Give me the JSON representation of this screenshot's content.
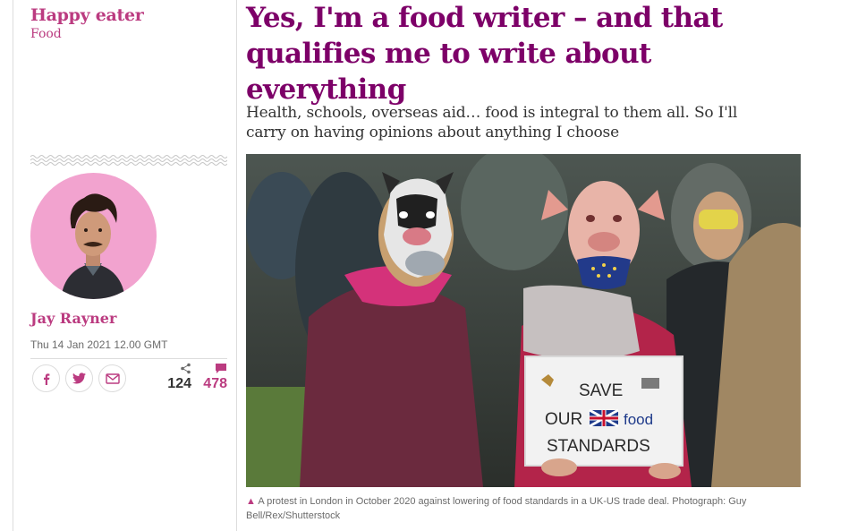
{
  "kicker": {
    "series": "Happy eater",
    "section": "Food"
  },
  "author": {
    "name": "Jay Rayner",
    "date": "Thu 14 Jan 2021 12.00 GMT"
  },
  "share": {
    "icons": [
      "facebook-icon",
      "twitter-icon",
      "email-icon"
    ],
    "share_count": "124",
    "comment_count": "478"
  },
  "article": {
    "headline": "Yes, I'm a food writer – and that qualifies me to write about everything",
    "standfirst": "Health, schools, overseas aid… food is integral to them all. So I'll carry on having opinions about anything I choose"
  },
  "photo": {
    "placard_line1": "SAVE",
    "placard_line2_a": "OUR",
    "placard_line2_b": "food",
    "placard_line3": "STANDARDS"
  },
  "caption": {
    "marker": "▲",
    "text": "A protest in London in October 2020 against lowering of food standards in a UK-US trade deal. Photograph: Guy Bell/Rex/Shutterstock"
  },
  "colors": {
    "accent": "#bb3b80",
    "headline": "#7d0068",
    "avatar_bg": "#f2a3cf"
  }
}
